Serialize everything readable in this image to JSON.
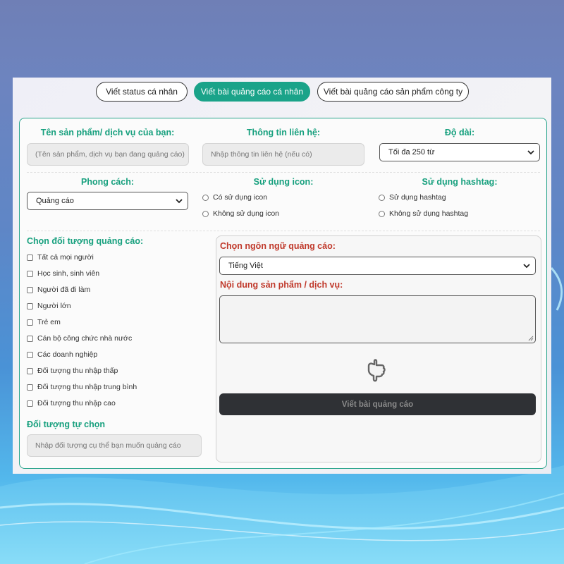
{
  "tabs": [
    {
      "label": "Viết status cá nhân",
      "active": false
    },
    {
      "label": "Viết bài quảng cáo cá nhân",
      "active": true
    },
    {
      "label": "Viết bài quảng cáo sản phẩm công ty",
      "active": false
    }
  ],
  "form": {
    "product_label": "Tên sản phẩm/ dịch vụ của bạn:",
    "product_placeholder": "(Tên sản phẩm, dịch vụ bạn đang quảng cáo)",
    "contact_label": "Thông tin liên hệ:",
    "contact_placeholder": "Nhập thông tin liên hệ (nếu có)",
    "length_label": "Độ dài:",
    "length_value": "Tối đa 250 từ",
    "style_label": "Phong cách:",
    "style_value": "Quảng cáo",
    "icon_label": "Sử dụng icon:",
    "icon_options": [
      "Có sử dụng icon",
      "Không sử dụng icon"
    ],
    "hashtag_label": "Sử dụng hashtag:",
    "hashtag_options": [
      "Sử dụng hashtag",
      "Không sử dụng hashtag"
    ],
    "audience_label": "Chọn đối tượng quảng cáo:",
    "audience_options": [
      "Tất cả mọi người",
      "Học sinh, sinh viên",
      "Người đã đi làm",
      "Người lớn",
      "Trẻ em",
      "Cán bộ công chức nhà nước",
      "Các doanh nghiệp",
      "Đối tượng thu nhập thấp",
      "Đối tượng thu nhập trung bình",
      "Đối tượng thu nhập cao"
    ],
    "custom_audience_label": "Đối tượng tự chọn",
    "custom_audience_placeholder": "Nhập đối tượng cụ thể bạn muốn quảng cáo",
    "language_label": "Chọn ngôn ngữ quảng cáo:",
    "language_value": "Tiếng Việt",
    "content_label": "Nội dung sản phẩm / dịch vụ:",
    "submit_label": "Viết bài quảng cáo"
  },
  "colors": {
    "accent": "#1aa389",
    "label_green": "#17a07e",
    "label_red": "#c0392b",
    "button_dark": "#2f3135"
  }
}
